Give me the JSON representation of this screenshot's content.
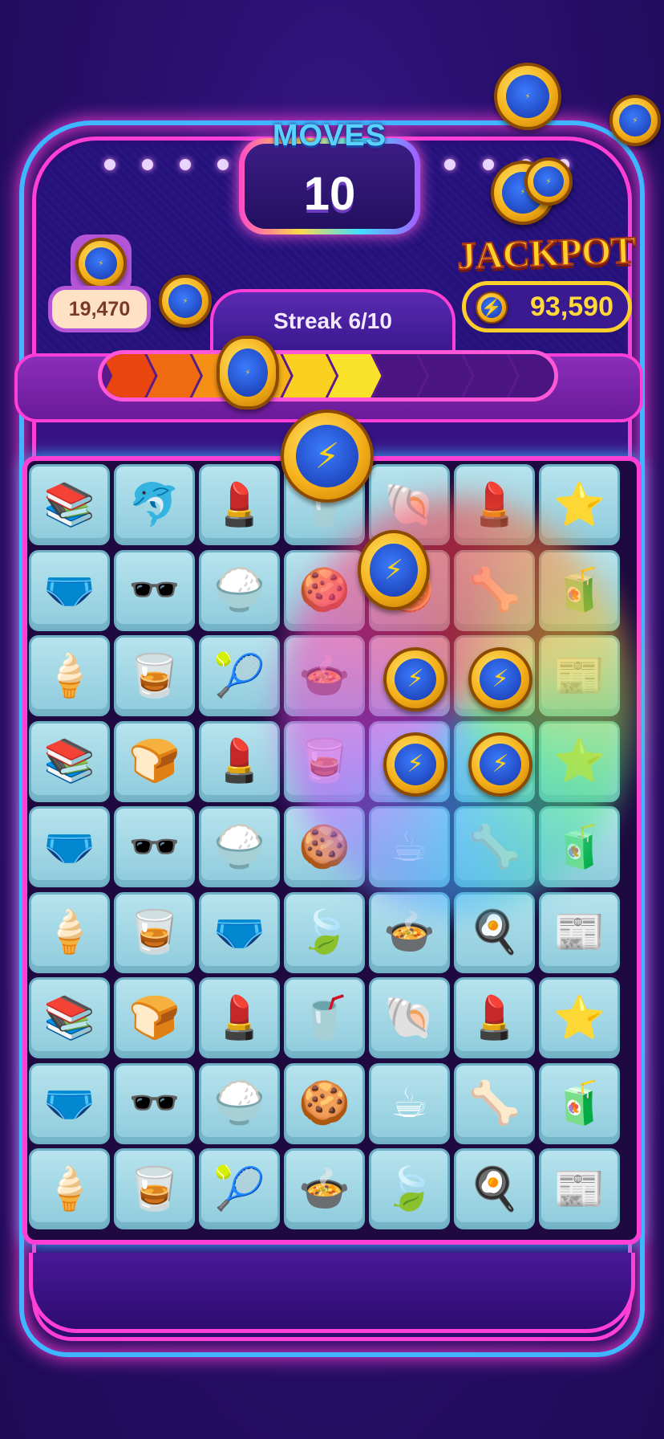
{
  "hud": {
    "moves_label": "MOVES",
    "moves_value": "10",
    "coin_balance": "19,470",
    "streak_label": "Streak 6/10",
    "streak_current": 6,
    "streak_total": 10,
    "jackpot_label": "JACKPOT",
    "jackpot_value": "93,590"
  },
  "icons": {
    "coin": "lightning-coin-icon",
    "bolt_glyph": "⚡"
  },
  "board": {
    "rows": [
      [
        "📚",
        "🐬",
        "💄",
        "🥤",
        "🐚",
        "💄",
        "⭐"
      ],
      [
        "🩲",
        "🕶️",
        "🍚",
        "🍪",
        "🪙",
        "🦴",
        "🧃"
      ],
      [
        "🍦",
        "🥃",
        "🎾",
        "🍲",
        "🪙",
        "🪙",
        "📰"
      ],
      [
        "📚",
        "🍞",
        "💄",
        "🥃",
        "🪙",
        "🪙",
        "⭐"
      ],
      [
        "🩲",
        "🕶️",
        "🍚",
        "🍪",
        "☕",
        "🦴",
        "🧃"
      ],
      [
        "🍦",
        "🥃",
        "🩲",
        "🍃",
        "🍲",
        "🍳",
        "📰"
      ],
      [
        "📚",
        "🍞",
        "💄",
        "🥤",
        "🐚",
        "💄",
        "⭐"
      ],
      [
        "🩲",
        "🕶️",
        "🍚",
        "🍪",
        "☕",
        "🦴",
        "🧃"
      ],
      [
        "🍦",
        "🥃",
        "🎾",
        "🍲",
        "🍃",
        "🍳",
        "📰"
      ]
    ]
  },
  "colors": {
    "accent_pink": "#ff3fd6",
    "accent_blue": "#3fb6ff",
    "gold": "#ffcf2a",
    "tile": "#a8dbe8"
  }
}
